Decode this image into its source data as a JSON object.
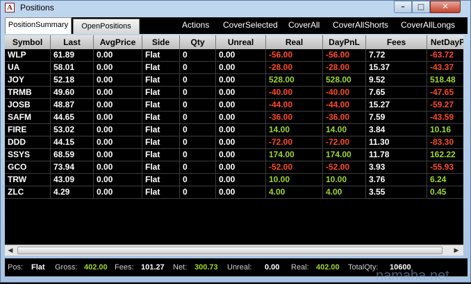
{
  "window": {
    "title": "Positions",
    "icon_letter": "A",
    "min": "–",
    "max": "□",
    "close": "✕"
  },
  "tabs": [
    {
      "label": "PositionSummary"
    },
    {
      "label": "OpenPositions"
    }
  ],
  "actions": [
    "Actions",
    "CoverSelected",
    "CoverAll",
    "CoverAllShorts",
    "CoverAllLongs"
  ],
  "columns": [
    "Symbol",
    "Last",
    "AvgPrice",
    "Side",
    "Qty",
    "Unreal",
    "Real",
    "DayPnL",
    "Fees",
    "NetDayP"
  ],
  "rows": [
    [
      "WLP",
      "61.89",
      "0.00",
      "Flat",
      "0",
      "0.00",
      "-56.00",
      "-56.00",
      "7.72",
      "-63.72"
    ],
    [
      "UA",
      "58.01",
      "0.00",
      "Flat",
      "0",
      "0.00",
      "-28.00",
      "-28.00",
      "15.37",
      "-43.37"
    ],
    [
      "JOY",
      "52.18",
      "0.00",
      "Flat",
      "0",
      "0.00",
      "528.00",
      "528.00",
      "9.52",
      "518.48"
    ],
    [
      "TRMB",
      "49.60",
      "0.00",
      "Flat",
      "0",
      "0.00",
      "-40.00",
      "-40.00",
      "7.65",
      "-47.65"
    ],
    [
      "JOSB",
      "48.87",
      "0.00",
      "Flat",
      "0",
      "0.00",
      "-44.00",
      "-44.00",
      "15.27",
      "-59.27"
    ],
    [
      "SAFM",
      "44.65",
      "0.00",
      "Flat",
      "0",
      "0.00",
      "-36.00",
      "-36.00",
      "7.59",
      "-43.59"
    ],
    [
      "FIRE",
      "53.02",
      "0.00",
      "Flat",
      "0",
      "0.00",
      "14.00",
      "14.00",
      "3.84",
      "10.16"
    ],
    [
      "DDD",
      "44.15",
      "0.00",
      "Flat",
      "0",
      "0.00",
      "-72.00",
      "-72.00",
      "11.30",
      "-83.30"
    ],
    [
      "SSYS",
      "68.59",
      "0.00",
      "Flat",
      "0",
      "0.00",
      "174.00",
      "174.00",
      "11.78",
      "162.22"
    ],
    [
      "GCO",
      "73.94",
      "0.00",
      "Flat",
      "0",
      "0.00",
      "-52.00",
      "-52.00",
      "3.93",
      "-55.93"
    ],
    [
      "TRW",
      "43.09",
      "0.00",
      "Flat",
      "0",
      "0.00",
      "10.00",
      "10.00",
      "3.76",
      "6.24"
    ],
    [
      "ZLC",
      "4.29",
      "0.00",
      "Flat",
      "0",
      "0.00",
      "4.00",
      "4.00",
      "3.55",
      "0.45"
    ]
  ],
  "scrollbar": {
    "left": "◀",
    "right": "▶"
  },
  "status": {
    "pos_label": "Pos:",
    "pos": "Flat",
    "gross_label": "Gross:",
    "gross": "402.00",
    "fees_label": "Fees:",
    "fees": "101.27",
    "net_label": "Net:",
    "net": "300.73",
    "unreal_label": "Unreal:",
    "unreal": "0.00",
    "real_label": "Real:",
    "real": "402.00",
    "totalqty_label": "TotalQty:",
    "totalqty": "10600"
  },
  "watermark": "namaha.net",
  "colors": {
    "positive": "#9fd82c",
    "negative": "#ff4a2a"
  }
}
